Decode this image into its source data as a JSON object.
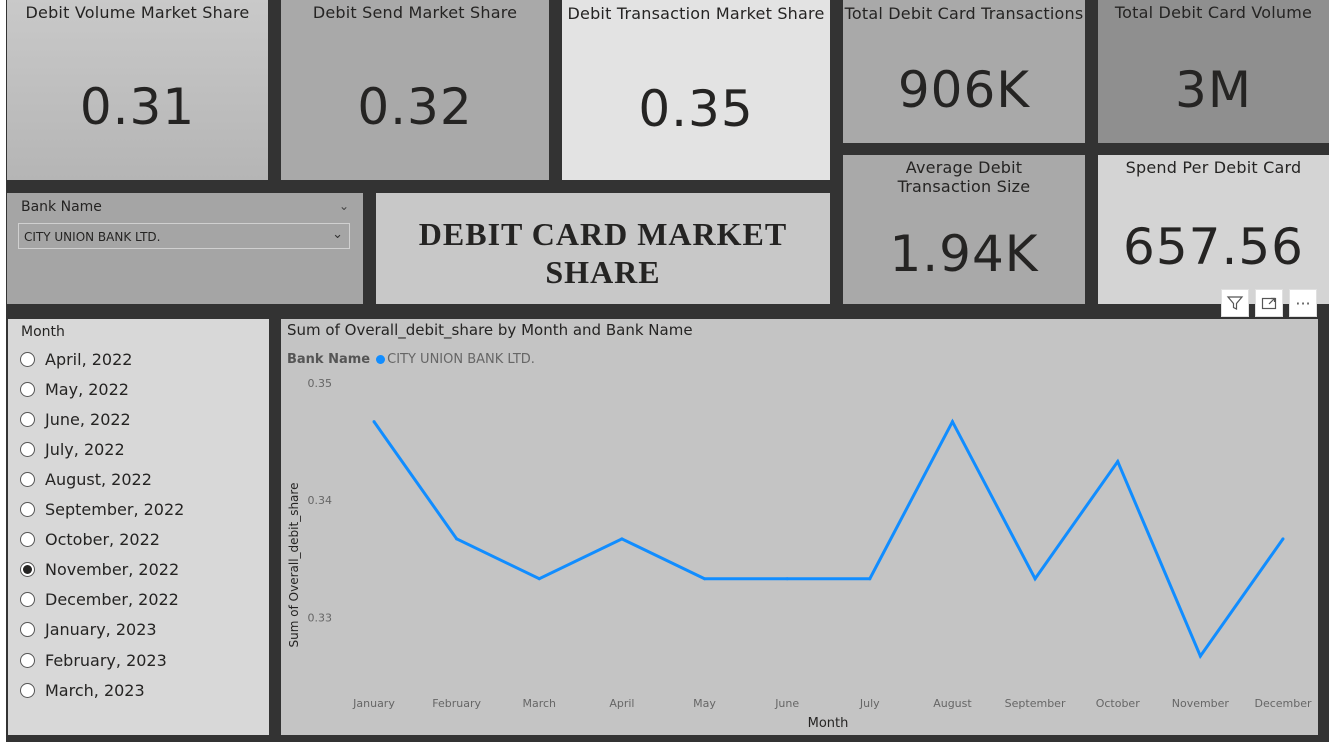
{
  "cards": {
    "debit_volume_share": {
      "title": "Debit Volume Market Share",
      "value": "0.31"
    },
    "debit_send_share": {
      "title": "Debit Send Market Share",
      "value": "0.32"
    },
    "debit_txn_share": {
      "title": "Debit Transaction Market Share",
      "value": "0.35"
    },
    "total_debit_txns": {
      "title": "Total Debit Card Transactions",
      "value": "906K"
    },
    "total_debit_volume": {
      "title": "Total Debit Card Volume",
      "value": "3M"
    },
    "avg_txn_size": {
      "title": "Average Debit Transaction Size",
      "value": "1.94K"
    },
    "spend_per_card": {
      "title": "Spend Per Debit Card",
      "value": "657.56"
    }
  },
  "bank_slicer": {
    "label": "Bank Name",
    "selected": "CITY UNION BANK LTD."
  },
  "report_title": "DEBIT CARD MARKET SHARE",
  "month_slicer": {
    "label": "Month",
    "options": [
      "April, 2022",
      "May, 2022",
      "June, 2022",
      "July, 2022",
      "August, 2022",
      "September, 2022",
      "October, 2022",
      "November, 2022",
      "December, 2022",
      "January, 2023",
      "February, 2023",
      "March, 2023"
    ],
    "selected_index": 7
  },
  "toolbar": {
    "filter_icon": "filter-icon",
    "focus_icon": "focus-mode-icon",
    "more_icon": "more-options-icon",
    "more_label": "···"
  },
  "chart_data": {
    "type": "line",
    "title": "Sum of Overall_debit_share by Month and Bank Name",
    "legend_title": "Bank Name",
    "xlabel": "Month",
    "ylabel": "Sum of Overall_debit_share",
    "categories": [
      "January",
      "February",
      "March",
      "April",
      "May",
      "June",
      "July",
      "August",
      "September",
      "October",
      "November",
      "December"
    ],
    "series": [
      {
        "name": "CITY UNION BANK LTD.",
        "color": "#118dff",
        "values": [
          0.3467,
          0.3367,
          0.3333,
          0.3367,
          0.3333,
          0.3333,
          0.3333,
          0.3467,
          0.3333,
          0.3433,
          0.3267,
          0.3367
        ]
      }
    ],
    "yticks": [
      "0.35",
      "0.34",
      "0.33"
    ],
    "ylim": [
      0.325,
      0.35
    ],
    "grid": false,
    "legend_position": "top-left"
  }
}
